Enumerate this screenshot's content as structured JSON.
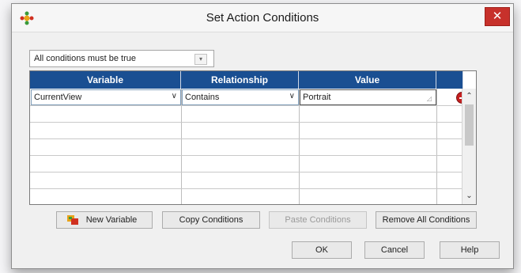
{
  "window": {
    "title": "Set Action Conditions",
    "close_glyph": "✕"
  },
  "condition_mode": {
    "selected": "All conditions must be true",
    "arrow": "▾"
  },
  "grid": {
    "columns": [
      "Variable",
      "Relationship",
      "Value"
    ],
    "row": {
      "variable": "CurrentView",
      "relationship": "Contains",
      "value": "Portrait"
    },
    "combo_arrow": "∨"
  },
  "scrollbar": {
    "up": "⌃",
    "down": "⌄"
  },
  "buttons": {
    "new_variable": "New Variable",
    "copy_conditions": "Copy Conditions",
    "paste_conditions": "Paste Conditions",
    "remove_all": "Remove All Conditions",
    "ok": "OK",
    "cancel": "Cancel",
    "help": "Help"
  }
}
